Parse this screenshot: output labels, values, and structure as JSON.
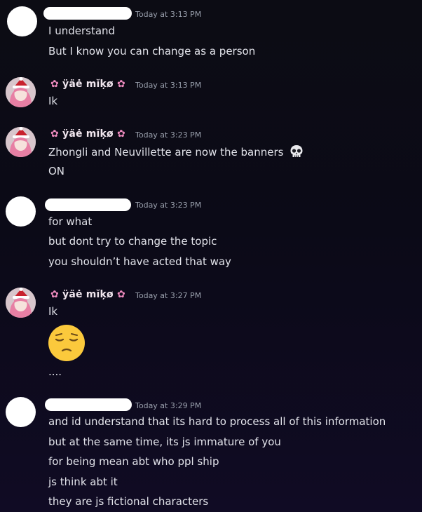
{
  "messages": [
    {
      "author": "",
      "author_redacted": true,
      "timestamp": "Today at 3:13 PM",
      "lines": [
        "I understand",
        "But I know you can change as a person"
      ]
    },
    {
      "author": "ÿäė mĭķø",
      "author_redacted": false,
      "timestamp": "Today at 3:13 PM",
      "lines": [
        "Ik"
      ]
    },
    {
      "author": "ÿäė mĭķø",
      "author_redacted": false,
      "timestamp": "Today at 3:23 PM",
      "lines": [
        "Zhongli and Neuvillette are now the banners",
        "ON"
      ]
    },
    {
      "author": "",
      "author_redacted": true,
      "timestamp": "Today at 3:23 PM",
      "lines": [
        "for what",
        "but dont try to change the topic",
        "you shouldn’t have acted that way"
      ]
    },
    {
      "author": "ÿäė mĭķø",
      "author_redacted": false,
      "timestamp": "Today at 3:27 PM",
      "lines": [
        "Ik",
        "...."
      ],
      "big_emoji": "pensive-face"
    },
    {
      "author": "",
      "author_redacted": true,
      "timestamp": "Today at 3:29 PM",
      "lines": [
        "and id understand that its hard to process all of this information",
        "but at the same time, its js immature of you",
        "for being mean abt who ppl ship",
        "js think abt it",
        "they are js fictional characters"
      ]
    }
  ],
  "icons": {
    "name_decoration": "cherry-blossom-icon",
    "inline_emoji": "skull-icon",
    "big_emoji": "pensive-face-icon"
  },
  "colors": {
    "background": "#0c0c14",
    "text": "#e2e3ea",
    "timestamp": "#9aa0ad",
    "flower": "#f08cc0"
  }
}
